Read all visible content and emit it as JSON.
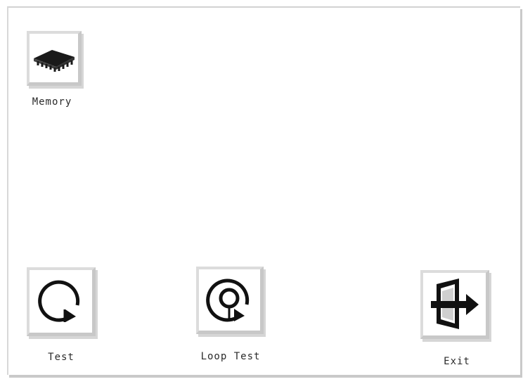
{
  "desktop": {
    "icons": {
      "memory": {
        "label": "Memory",
        "icon": "memory-chip-icon"
      },
      "test": {
        "label": "Test",
        "icon": "refresh-circle-icon"
      },
      "loop_test": {
        "label": "Loop Test",
        "icon": "loop-circle-icon"
      },
      "exit": {
        "label": "Exit",
        "icon": "exit-door-icon"
      }
    }
  },
  "colors": {
    "background": "#ffffff",
    "bevel_light": "#dcdcdc",
    "bevel_dark": "#c8c8c8",
    "icon_ink": "#111111"
  }
}
